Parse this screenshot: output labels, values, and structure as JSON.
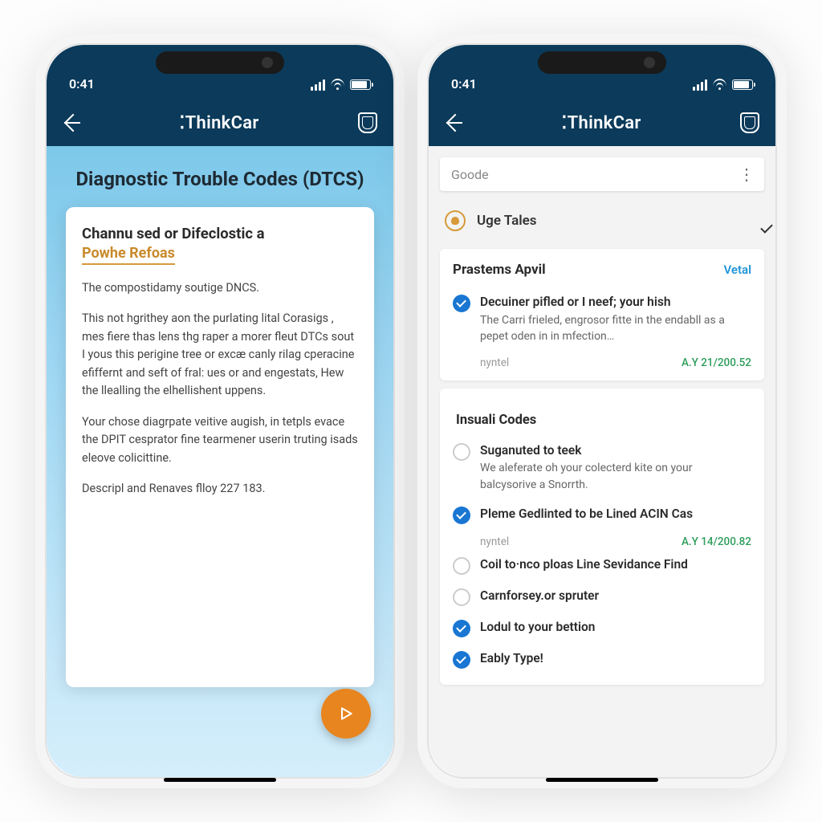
{
  "status": {
    "time": "0:41"
  },
  "header": {
    "title": "⁚ThinkCar"
  },
  "phone1": {
    "pageTitle": "Diagnostic Trouble Codes (DTCS)",
    "cardTitle": "Channu sed or Difeclostic a",
    "cardSub": "Powhe Refoas",
    "p1": "The compostidamy soutige DNCS.",
    "p2": "This not hgrithey aon the purlating lital Corasigs , mes fiere thas lens thg raper a morer fleut DTCs sout I yous this perigine tree or excæ canly rilag cperacine efiffernt and seft of fral: ues or and engestats, Hew the llealling the elhellishent uppens.",
    "p3": "Your chose diagrpate veitive augish, in tetpls evace the DPIT cesprator fine tearmener userin truting isads eleove colicittine.",
    "p4": "Descripl and Renaves flloy 227 183."
  },
  "phone2": {
    "searchPlaceholder": "Goode",
    "userRow": "Uge Tales",
    "card1": {
      "title": "Prastems Apvil",
      "action": "Vetal",
      "item1": {
        "title": "Decuiner pifled or I neef; your hish",
        "desc": "The Carri frieled, engrosor fitte in the endabll as a pepet oden in in mfection…"
      },
      "meta1": {
        "left": "nyntel",
        "right": "A.Y 21/200.52"
      }
    },
    "card2": {
      "title": "Insuali Codes",
      "item1": {
        "title": "Suganuted to teek",
        "desc": "We aleferate oh your colecterd kite on your balcysorive a Snorrth."
      },
      "item2": {
        "title": "Pleme Gedlinted to be Lined ACIN Cas"
      },
      "meta2": {
        "left": "nyntel",
        "right": "A.Y 14/200.82"
      },
      "item3": {
        "title": "Coil to·nco ploas Line Sevidance Find"
      },
      "item4": {
        "title": "Carnforsey.or spruter"
      },
      "item5": {
        "title": "Lodul to your bettion"
      },
      "item6": {
        "title": "Eably Type!"
      }
    }
  }
}
